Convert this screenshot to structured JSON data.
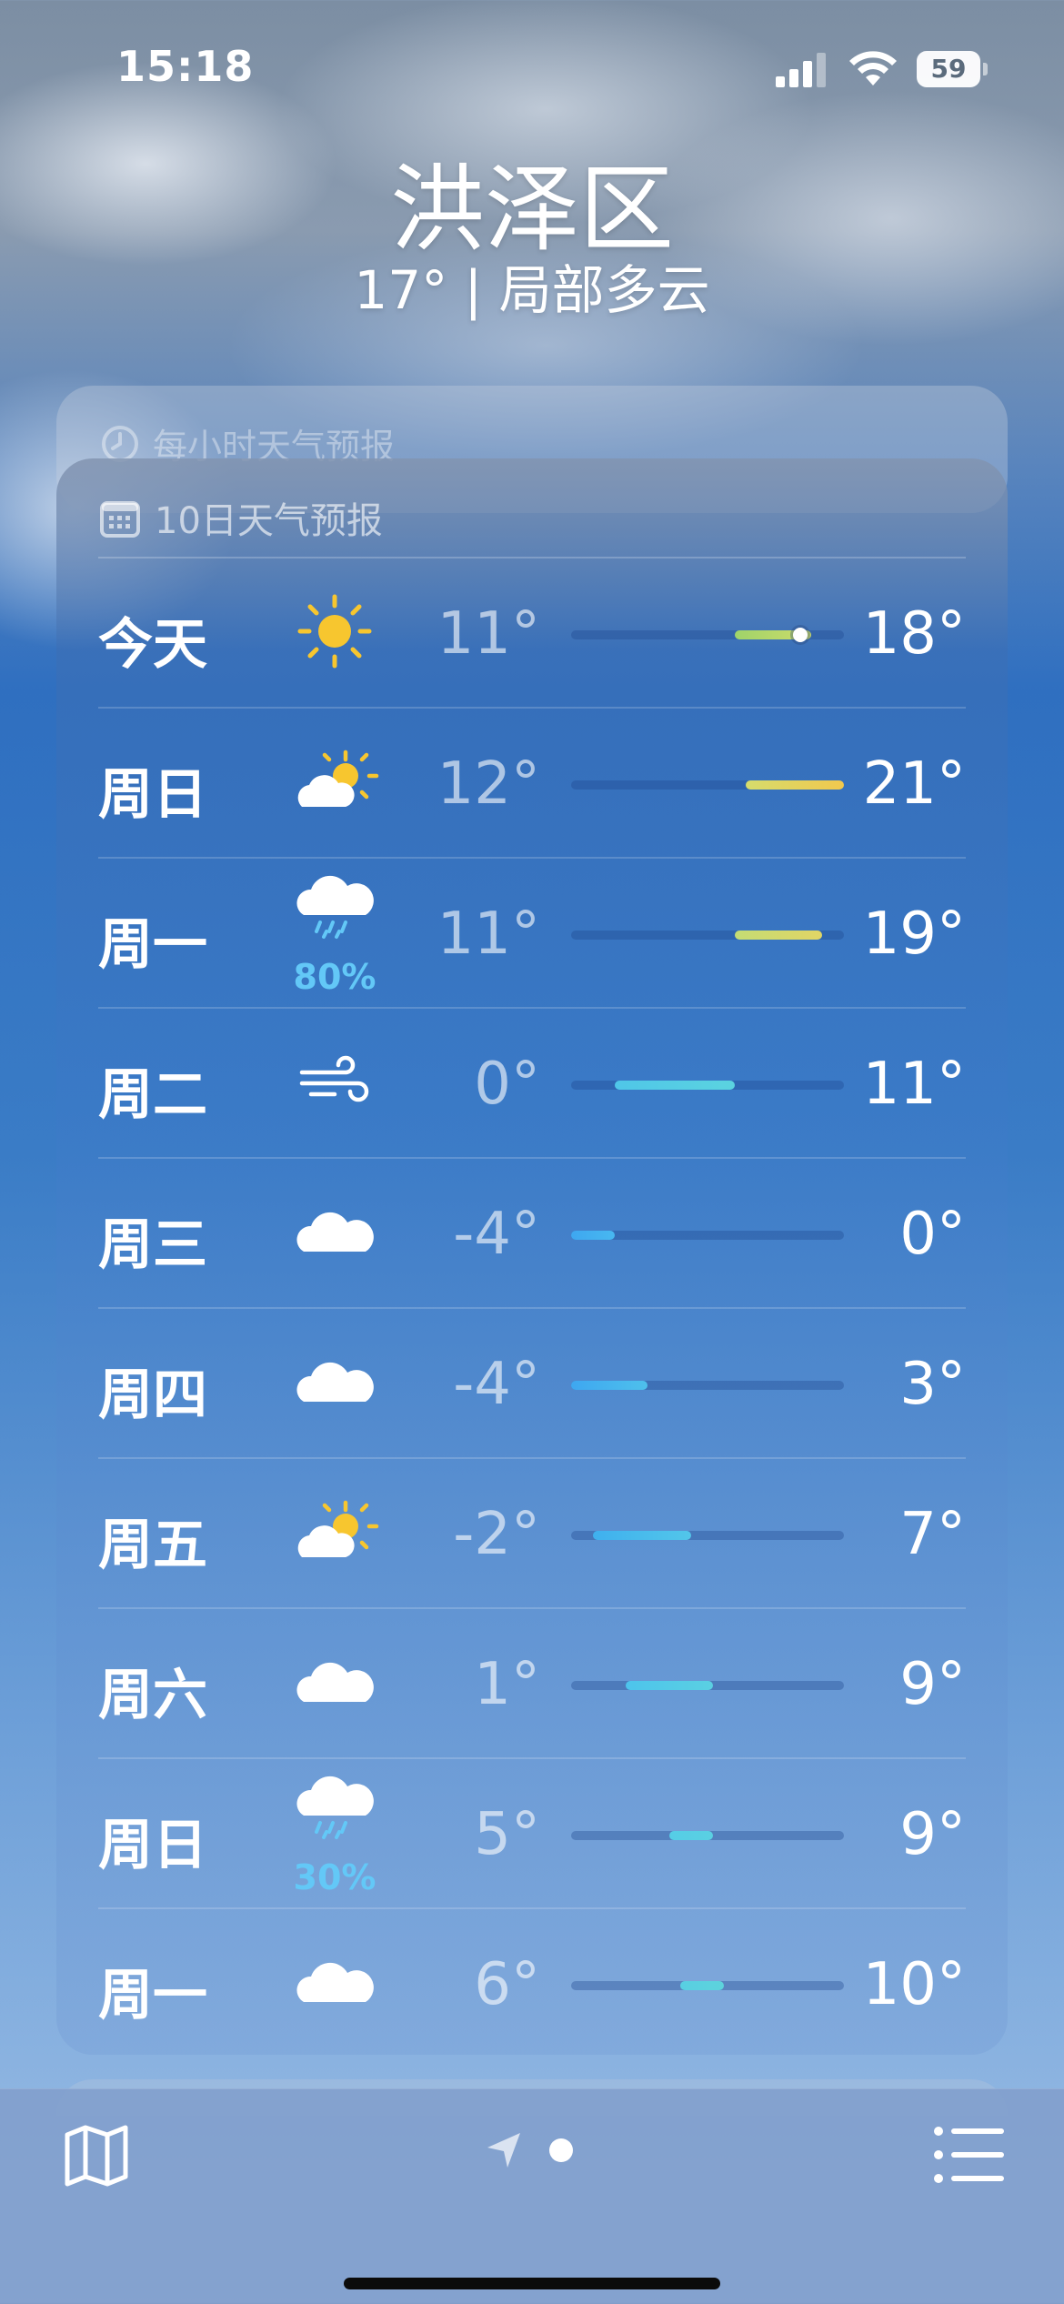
{
  "status_bar": {
    "time": "15:18",
    "battery": "59"
  },
  "location": {
    "city": "洪泽区",
    "summary": "17° | 局部多云"
  },
  "hourly_card": {
    "title": "每小时天气预报",
    "icon": "clock-icon"
  },
  "forecast": {
    "title": "10日天气预报",
    "icon": "calendar-icon",
    "range_min": -4,
    "range_max": 21,
    "days": [
      {
        "day": "今天",
        "icon": "sun-icon",
        "precip": "",
        "low": "11°",
        "high": "18°",
        "low_val": 11,
        "high_val": 18,
        "current_val": 17,
        "color_from": "#9fd36a",
        "color_to": "#cddc6a"
      },
      {
        "day": "周日",
        "icon": "partly-sunny-icon",
        "precip": "",
        "low": "12°",
        "high": "21°",
        "low_val": 12,
        "high_val": 21,
        "color_from": "#d6dc6c",
        "color_to": "#f1c84e"
      },
      {
        "day": "周一",
        "icon": "rain-cloud-icon",
        "precip": "80%",
        "low": "11°",
        "high": "19°",
        "low_val": 11,
        "high_val": 19,
        "color_from": "#c4dc74",
        "color_to": "#e1d565"
      },
      {
        "day": "周二",
        "icon": "wind-icon",
        "precip": "",
        "low": "0°",
        "high": "11°",
        "low_val": 0,
        "high_val": 11,
        "color_from": "#4fc6e8",
        "color_to": "#5bd3e0"
      },
      {
        "day": "周三",
        "icon": "cloud-icon",
        "precip": "",
        "low": "-4°",
        "high": "0°",
        "low_val": -4,
        "high_val": 0,
        "color_from": "#3ea7f0",
        "color_to": "#48b8f0"
      },
      {
        "day": "周四",
        "icon": "cloud-icon",
        "precip": "",
        "low": "-4°",
        "high": "3°",
        "low_val": -4,
        "high_val": 3,
        "color_from": "#3ea7f0",
        "color_to": "#4ec0ec"
      },
      {
        "day": "周五",
        "icon": "partly-sunny-icon",
        "precip": "",
        "low": "-2°",
        "high": "7°",
        "low_val": -2,
        "high_val": 7,
        "color_from": "#3fb0ee",
        "color_to": "#52c6ea"
      },
      {
        "day": "周六",
        "icon": "cloud-icon",
        "precip": "",
        "low": "1°",
        "high": "9°",
        "low_val": 1,
        "high_val": 9,
        "color_from": "#4dc4ec",
        "color_to": "#5ad0e2"
      },
      {
        "day": "周日",
        "icon": "rain-cloud-icon",
        "precip": "30%",
        "low": "5°",
        "high": "9°",
        "low_val": 5,
        "high_val": 9,
        "color_from": "#55cde6",
        "color_to": "#5ad0e2"
      },
      {
        "day": "周一",
        "icon": "cloud-icon",
        "precip": "",
        "low": "6°",
        "high": "10°",
        "low_val": 6,
        "high_val": 10,
        "color_from": "#58cfe2",
        "color_to": "#5dd3dc"
      }
    ]
  },
  "toolbar": {
    "map_icon": "map-icon",
    "location_icon": "location-arrow-icon",
    "list_icon": "list-icon"
  }
}
